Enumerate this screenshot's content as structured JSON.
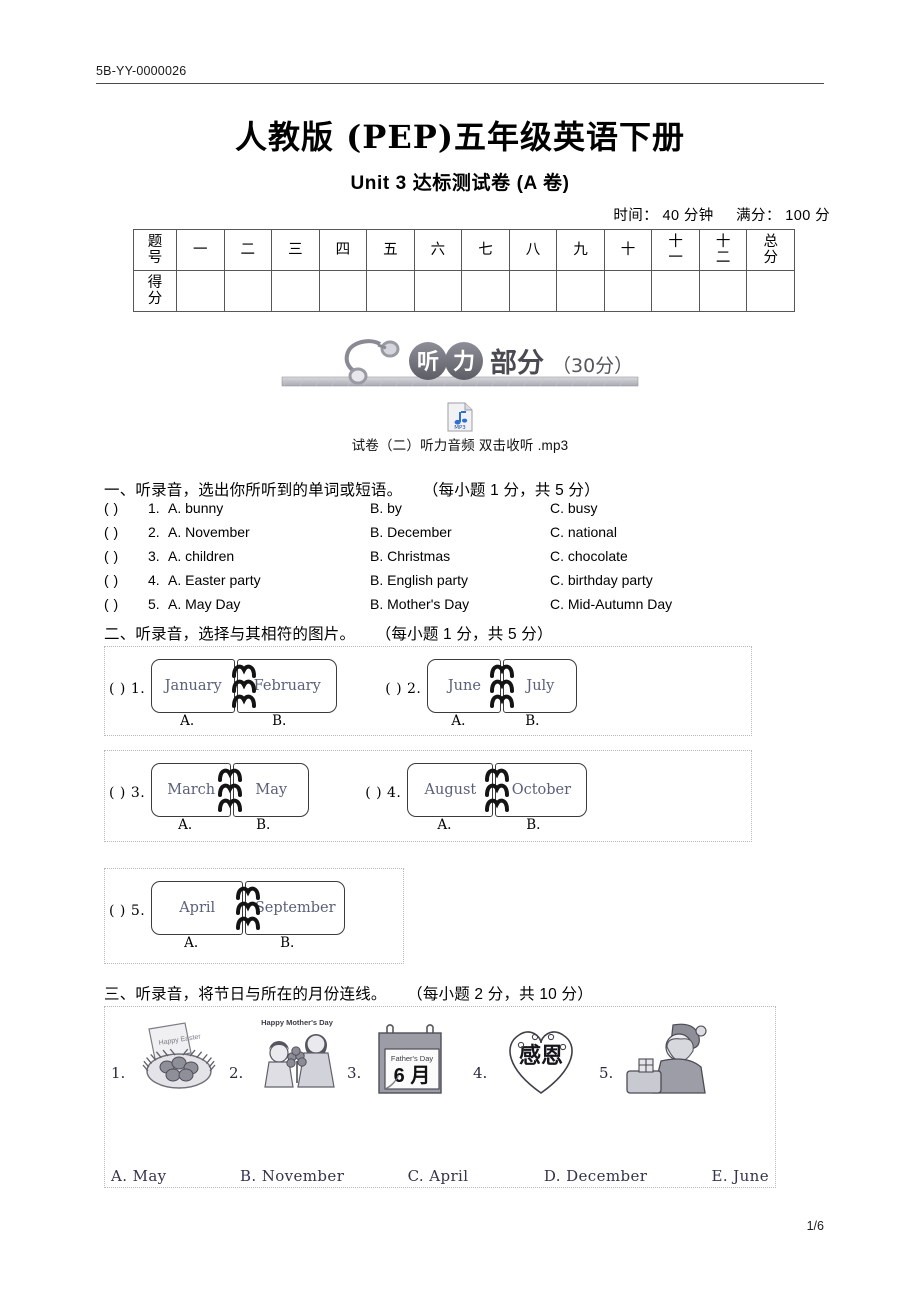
{
  "header": {
    "code": "5B-YY-0000026"
  },
  "title": {
    "main": "人教版 (PEP)五年级英语下册",
    "sub": "Unit 3  达标测试卷 (A 卷)"
  },
  "exam_meta": {
    "time": "时间： 40 分钟",
    "full_score": "满分： 100 分"
  },
  "score_table": {
    "row_labels": [
      "题号",
      "得分"
    ],
    "row1_label_lines": [
      "题",
      "号"
    ],
    "row2_label_lines": [
      "得",
      "分"
    ],
    "columns": [
      {
        "lines": [
          "一"
        ]
      },
      {
        "lines": [
          "二"
        ]
      },
      {
        "lines": [
          "三"
        ]
      },
      {
        "lines": [
          "四"
        ]
      },
      {
        "lines": [
          "五"
        ]
      },
      {
        "lines": [
          "六"
        ]
      },
      {
        "lines": [
          "七"
        ]
      },
      {
        "lines": [
          "八"
        ]
      },
      {
        "lines": [
          "九"
        ]
      },
      {
        "lines": [
          "十"
        ]
      },
      {
        "lines": [
          "十",
          "一"
        ]
      },
      {
        "lines": [
          "十",
          "二"
        ]
      },
      {
        "lines": [
          "总",
          "分"
        ]
      }
    ]
  },
  "listening_banner": {
    "label": "听力部分",
    "points": "（30分）",
    "icon": "headphones-icon"
  },
  "audio": {
    "icon": "mp3-file-icon",
    "caption": "试卷（二）听力音频  双击收听 .mp3"
  },
  "section1": {
    "heading": "一、听录音，选出你所听到的单词或短语。",
    "points": "（每小题 1 分，共 5 分）",
    "bracket": "(        )",
    "items": [
      {
        "num": "1.",
        "a": "A. bunny",
        "b": "B. by",
        "c": "C. busy"
      },
      {
        "num": "2.",
        "a": "A. November",
        "b": "B. December",
        "c": "C. national"
      },
      {
        "num": "3.",
        "a": "A. children",
        "b": "B. Christmas",
        "c": "C. chocolate"
      },
      {
        "num": "4.",
        "a": "A. Easter party",
        "b": "B. English party",
        "c": "C. birthday party"
      },
      {
        "num": "5.",
        "a": "A. May Day",
        "b": "B. Mother's Day",
        "c": "C. Mid-Autumn Day"
      }
    ]
  },
  "section2": {
    "heading": "二、听录音，选择与其相符的图片。",
    "points": "（每小题 1 分，共 5 分）",
    "bracket": "(      )",
    "caption_a": "A.",
    "caption_b": "B.",
    "items": [
      {
        "num": "1.",
        "a": "January",
        "b": "February"
      },
      {
        "num": "2.",
        "a": "June",
        "b": "July"
      },
      {
        "num": "3.",
        "a": "March",
        "b": "May"
      },
      {
        "num": "4.",
        "a": "August",
        "b": "October"
      },
      {
        "num": "5.",
        "a": "April",
        "b": "September"
      }
    ]
  },
  "section3": {
    "heading": "三、听录音，将节日与所在的月份连线。",
    "points": "（每小题 2 分，共 10 分）",
    "pictures": [
      {
        "num": "1.",
        "icon": "easter-basket-icon",
        "label": "Happy Easter"
      },
      {
        "num": "2.",
        "icon": "mothers-day-icon",
        "label": "Happy Mother's Day"
      },
      {
        "num": "3.",
        "icon": "fathers-day-calendar-icon",
        "label": "Father's Day",
        "month": "6 月"
      },
      {
        "num": "4.",
        "icon": "thanksgiving-heart-icon",
        "label": "感恩节"
      },
      {
        "num": "5.",
        "icon": "santa-claus-icon",
        "label": "Christmas"
      }
    ],
    "options": [
      {
        "letter": "A.",
        "text": "May"
      },
      {
        "letter": "B.",
        "text": "November"
      },
      {
        "letter": "C.",
        "text": "April"
      },
      {
        "letter": "D.",
        "text": "December"
      },
      {
        "letter": "E.",
        "text": "June"
      }
    ]
  },
  "footer": {
    "page": "1/6"
  }
}
